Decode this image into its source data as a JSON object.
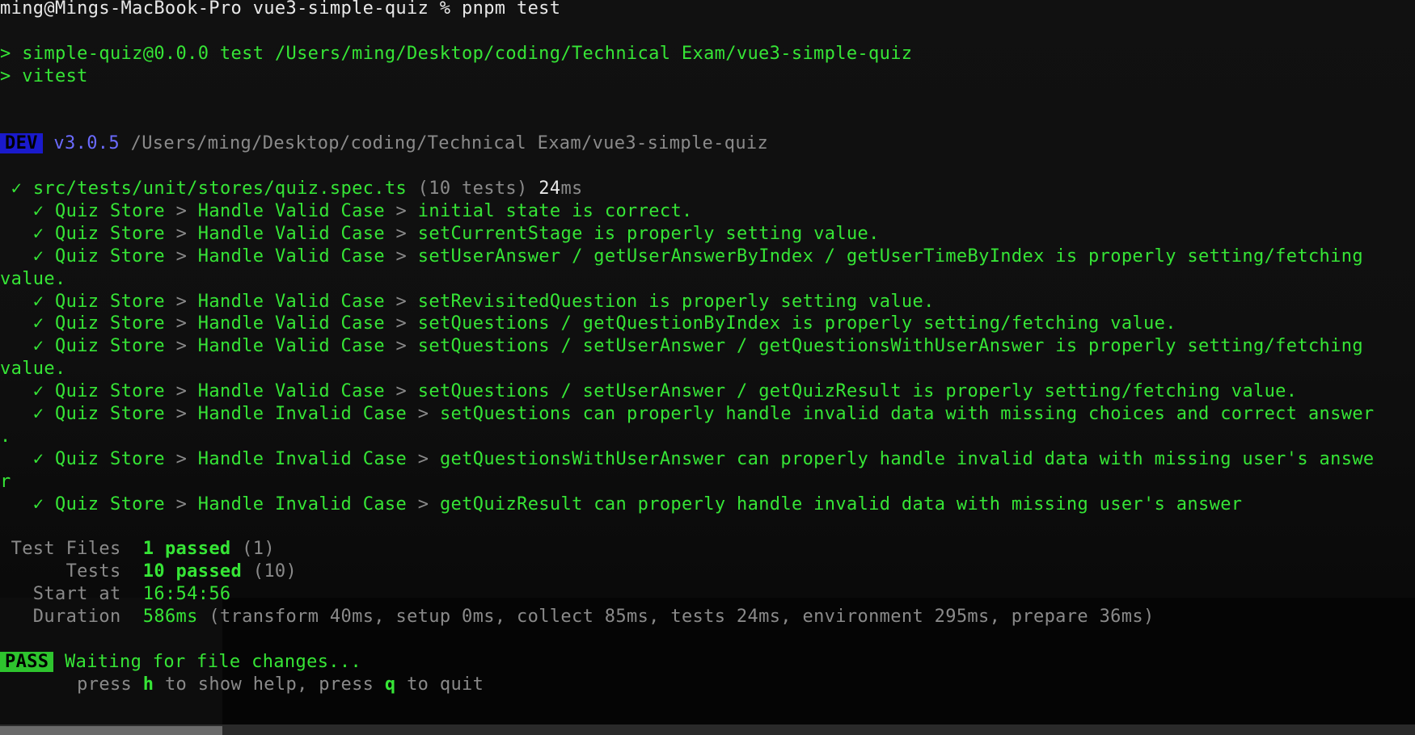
{
  "prompt": {
    "host": "ming@Mings-MacBook-Pro vue3-simple-quiz % ",
    "command": "pnpm test"
  },
  "script_lines": [
    "> simple-quiz@0.0.0 test /Users/ming/Desktop/coding/Technical Exam/vue3-simple-quiz",
    "> vitest"
  ],
  "dev_header": {
    "badge": "DEV",
    "version": "v3.0.5",
    "path": "/Users/ming/Desktop/coding/Technical Exam/vue3-simple-quiz"
  },
  "file_result": {
    "check": "✓",
    "file": "src/tests/unit/stores/quiz.spec.ts",
    "count": "(10 tests)",
    "time_value": "24",
    "time_unit": "ms"
  },
  "tests": [
    {
      "suite": "Quiz Store",
      "group": "Handle Valid Case",
      "name": "initial state is correct.",
      "wrap": ""
    },
    {
      "suite": "Quiz Store",
      "group": "Handle Valid Case",
      "name": "setCurrentStage is properly setting value.",
      "wrap": ""
    },
    {
      "suite": "Quiz Store",
      "group": "Handle Valid Case",
      "name": "setUserAnswer / getUserAnswerByIndex / getUserTimeByIndex is properly setting/fetching",
      "wrap": "value."
    },
    {
      "suite": "Quiz Store",
      "group": "Handle Valid Case",
      "name": "setRevisitedQuestion is properly setting value.",
      "wrap": ""
    },
    {
      "suite": "Quiz Store",
      "group": "Handle Valid Case",
      "name": "setQuestions / getQuestionByIndex is properly setting/fetching value.",
      "wrap": ""
    },
    {
      "suite": "Quiz Store",
      "group": "Handle Valid Case",
      "name": "setQuestions / setUserAnswer / getQuestionsWithUserAnswer is properly setting/fetching",
      "wrap": "value."
    },
    {
      "suite": "Quiz Store",
      "group": "Handle Valid Case",
      "name": "setQuestions / setUserAnswer / getQuizResult is properly setting/fetching value.",
      "wrap": ""
    },
    {
      "suite": "Quiz Store",
      "group": "Handle Invalid Case",
      "name": "setQuestions can properly handle invalid data with missing choices and correct answer",
      "wrap": "."
    },
    {
      "suite": "Quiz Store",
      "group": "Handle Invalid Case",
      "name": "getQuestionsWithUserAnswer can properly handle invalid data with missing user's answe",
      "wrap": "r"
    },
    {
      "suite": "Quiz Store",
      "group": "Handle Invalid Case",
      "name": "getQuizResult can properly handle invalid data with missing user's answer",
      "wrap": ""
    }
  ],
  "summary": {
    "files_label": "Test Files",
    "files_value": "1 passed",
    "files_count": "(1)",
    "tests_label": "Tests",
    "tests_value": "10 passed",
    "tests_count": "(10)",
    "start_label": "Start at",
    "start_value": "16:54:56",
    "duration_label": "Duration",
    "duration_value": "586ms",
    "duration_detail": "(transform 40ms, setup 0ms, collect 85ms, tests 24ms, environment 295ms, prepare 36ms)"
  },
  "status": {
    "badge": "PASS",
    "message": "Waiting for file changes...",
    "help_press1": "press ",
    "help_key1": "h",
    "help_text1": " to show help, press ",
    "help_key2": "q",
    "help_text2": " to quit"
  },
  "glyphs": {
    "check": "✓",
    "separator": ">"
  }
}
